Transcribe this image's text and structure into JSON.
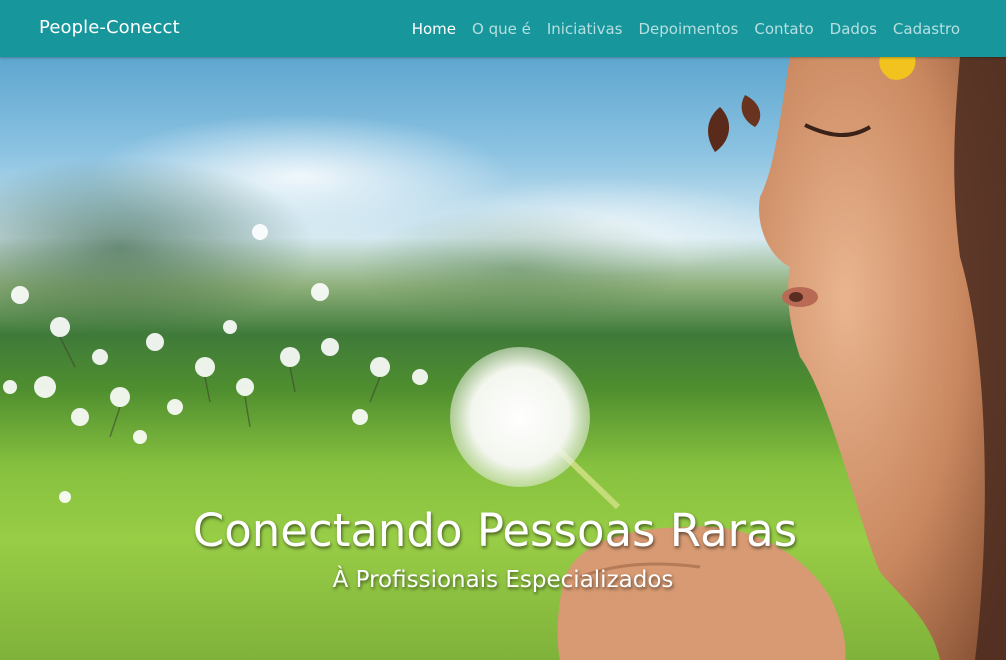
{
  "navbar": {
    "brand": "People-Conecct",
    "background": "#17979c",
    "links": [
      {
        "label": "Home",
        "active": true
      },
      {
        "label": "O que é",
        "active": false
      },
      {
        "label": "Iniciativas",
        "active": false
      },
      {
        "label": "Depoimentos",
        "active": false
      },
      {
        "label": "Contato",
        "active": false
      },
      {
        "label": "Dados",
        "active": false
      },
      {
        "label": "Cadastro",
        "active": false
      }
    ]
  },
  "hero": {
    "image_subject": "child blowing dandelion seeds in a green field",
    "headline": "Conectando Pessoas Raras",
    "subheadline": "À Profissionais Especializados"
  }
}
